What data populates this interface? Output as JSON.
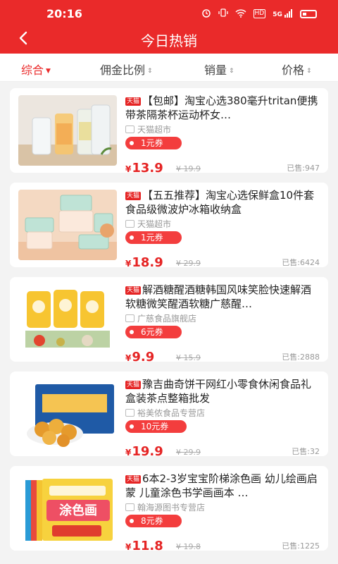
{
  "status_bar": {
    "time": "20:16",
    "net_label": "HD",
    "signal_label": "5G",
    "icons": [
      "alarm-icon",
      "wifi-icon",
      "signal-icon",
      "battery-icon"
    ]
  },
  "nav": {
    "back_icon": "back-chevron-icon",
    "title": "今日热销"
  },
  "sort_tabs": [
    {
      "label": "综合",
      "active": true
    },
    {
      "label": "佣金比例",
      "active": false
    },
    {
      "label": "销量",
      "active": false
    },
    {
      "label": "价格",
      "active": false
    }
  ],
  "colors": {
    "brand_red": "#ea2a2a",
    "price_red": "#e52424"
  },
  "products": [
    {
      "badge": "天猫",
      "title": "【包邮】淘宝心选380毫升tritan便携带茶隔茶杯运动杯女…",
      "shop": "天猫超市",
      "coupon": "1元券",
      "yen": "¥",
      "price": "13.9",
      "old_price": "¥ 19.9",
      "sold": "已售:947",
      "image": "water-bottles"
    },
    {
      "badge": "天猫",
      "title": "【五五推荐】淘宝心选保鲜盒10件套食品级微波炉冰箱收纳盒",
      "shop": "天猫超市",
      "coupon": "1元券",
      "yen": "¥",
      "price": "18.9",
      "old_price": "¥ 29.9",
      "sold": "已售:6424",
      "image": "food-containers"
    },
    {
      "badge": "天猫",
      "title": "解酒糖醒酒糖韩国风味笑脸快速解酒软糖微笑醒酒软糖广慈醒…",
      "shop": "广慈食品旗舰店",
      "coupon": "6元券",
      "yen": "¥",
      "price": "9.9",
      "old_price": "¥ 15.9",
      "sold": "已售:2888",
      "image": "hangover-candy"
    },
    {
      "badge": "天猫",
      "title": "豫吉曲奇饼干网红小零食休闲食品礼盒装茶点整箱批发",
      "shop": "裕美侬食品专营店",
      "coupon": "10元券",
      "yen": "¥",
      "price": "19.9",
      "old_price": "¥ 29.9",
      "sold": "已售:32",
      "image": "cookie-box"
    },
    {
      "badge": "天猫",
      "title": "6本2-3岁宝宝阶梯涂色画 幼儿绘画启蒙 儿童涂色书学画画本 …",
      "shop": "翰海源图书专营店",
      "coupon": "8元券",
      "yen": "¥",
      "price": "11.8",
      "old_price": "¥ 19.8",
      "sold": "已售:1225",
      "image": "coloring-books",
      "image_text": "涂色画"
    }
  ]
}
